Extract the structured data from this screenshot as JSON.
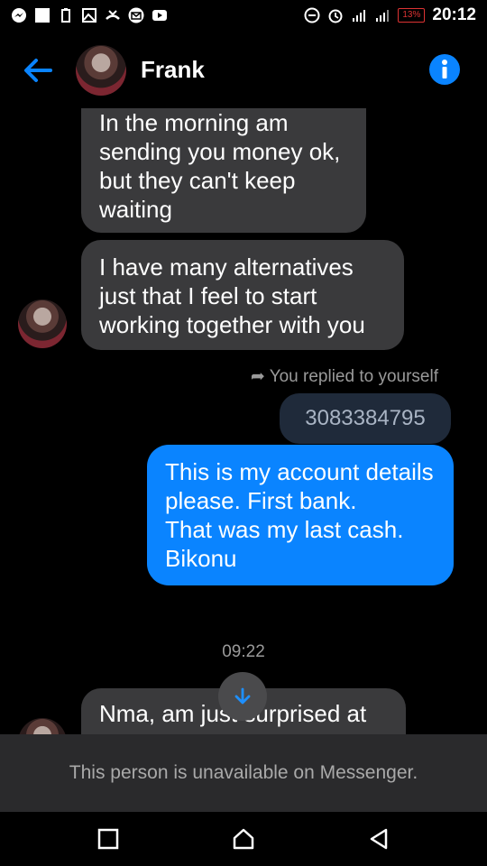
{
  "status_bar": {
    "time": "20:12",
    "battery": "13%",
    "left_icons": [
      "messenger-icon",
      "square-icon",
      "battery-saver-icon",
      "gallery-icon",
      "missed-call-icon",
      "email-icon",
      "youtube-icon"
    ],
    "right_icons": [
      "dnd-icon",
      "alarm-icon",
      "signal-icon",
      "signal-icon"
    ]
  },
  "header": {
    "contact_name": "Frank",
    "back_icon": "back-arrow-icon",
    "info_icon": "info-icon"
  },
  "messages": [
    {
      "direction": "in",
      "text": "In the morning am sending you money ok, but they can't keep waiting"
    },
    {
      "direction": "in",
      "text": "I have many alternatives just that I feel to start working together with you"
    },
    {
      "direction": "out",
      "reply_note": "You replied to yourself",
      "reply_preview": "3083384795",
      "text_lines": [
        "This is my account details please. First bank.",
        "That was my last cash.",
        "Bikonu"
      ]
    },
    {
      "timestamp": "09:22"
    },
    {
      "direction": "in",
      "text": "Nma, am just surprised at"
    }
  ],
  "notice": "This person is unavailable on Messenger.",
  "nav_icons": [
    "recent-apps-icon",
    "home-icon",
    "back-icon"
  ],
  "colors": {
    "accent": "#0a84ff",
    "incoming": "#3a3a3c",
    "background": "#000000"
  }
}
